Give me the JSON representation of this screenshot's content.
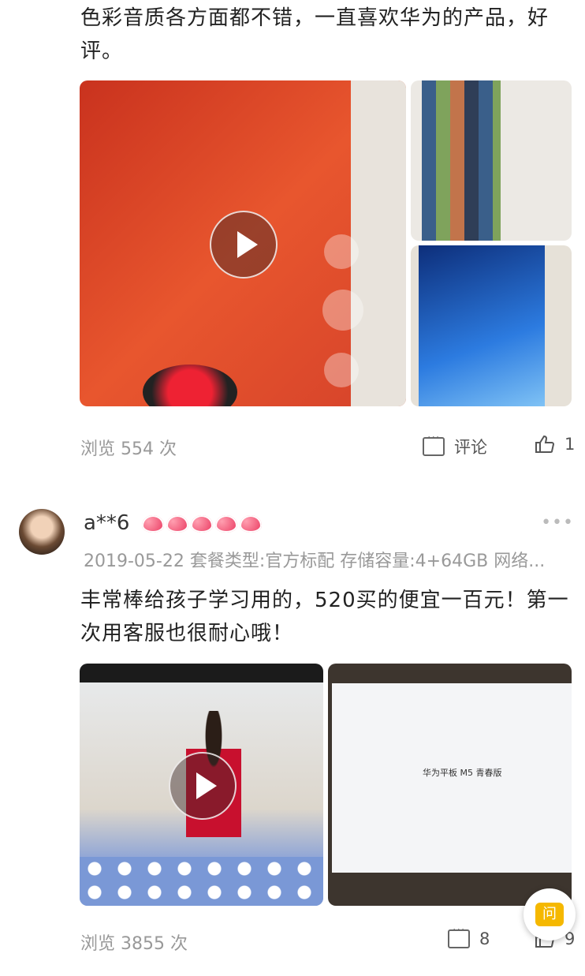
{
  "review1": {
    "text": "色彩音质各方面都不错，一直喜欢华为的产品，好评。",
    "views": "浏览 554 次",
    "comment_label": "评论",
    "like_count": "1"
  },
  "review2": {
    "username": "a**6",
    "hearts": 5,
    "meta": "2019-05-22 套餐类型:官方标配 存储容量:4+64GB 网络...",
    "text": "丰常棒给孩子学习用的，520买的便宜一百元！第一次用客服也很耐心哦！",
    "image2_caption": "华为平板 M5 青春版",
    "views": "浏览 3855 次",
    "comment_count": "8",
    "like_count": "9"
  },
  "float_button": {
    "label": "问"
  },
  "more_label": "•••",
  "colors": {
    "accent": "#f5b800",
    "heart": "#e9365e",
    "muted": "#999999"
  }
}
